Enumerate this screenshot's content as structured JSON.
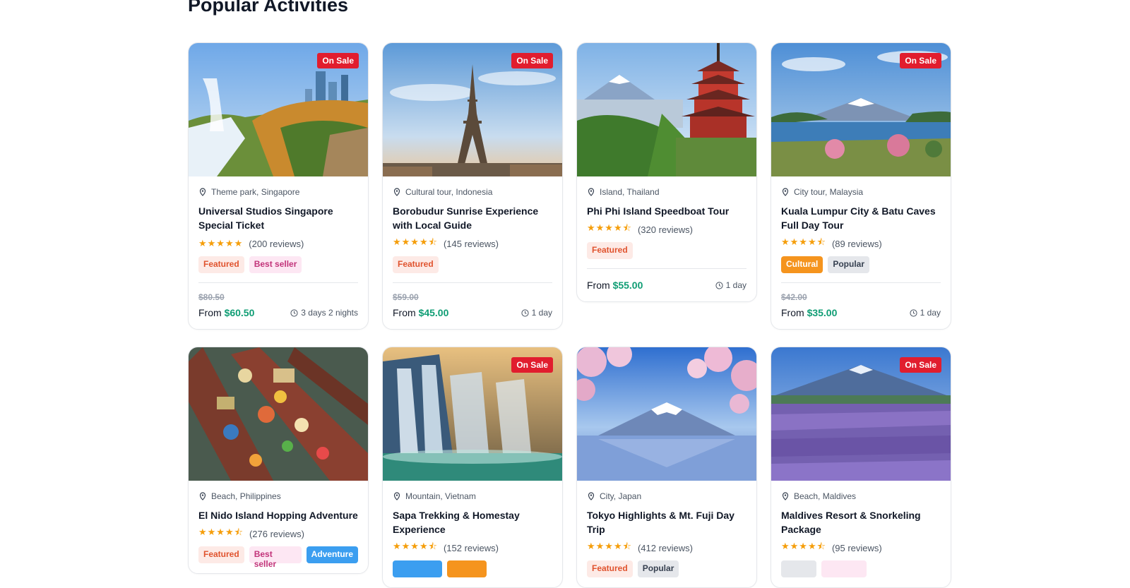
{
  "section": {
    "title": "Popular Activities"
  },
  "cards": [
    {
      "sale": "On Sale",
      "location": "Theme park, Singapore",
      "title": "Universal Studios Singapore Special Ticket",
      "stars": "★★★★★",
      "reviews": "(200 reviews)",
      "badges": [
        "Featured",
        "Best seller"
      ],
      "old_price": "$80.50",
      "from": "From",
      "price": "$60.50",
      "duration": "3 days 2 nights"
    },
    {
      "sale": "On Sale",
      "location": "Cultural tour, Indonesia",
      "title": "Borobudur Sunrise Experience with Local Guide",
      "stars": "★★★★⯪",
      "reviews": "(145 reviews)",
      "badges": [
        "Featured"
      ],
      "old_price": "$59.00",
      "from": "From",
      "price": "$45.00",
      "duration": "1 day"
    },
    {
      "sale": "",
      "location": "Island, Thailand",
      "title": "Phi Phi Island Speedboat Tour",
      "stars": "★★★★⯪",
      "reviews": "(320 reviews)",
      "badges": [
        "Featured"
      ],
      "old_price": "",
      "from": "From",
      "price": "$55.00",
      "duration": "1 day"
    },
    {
      "sale": "On Sale",
      "location": "City tour, Malaysia",
      "title": "Kuala Lumpur City & Batu Caves Full Day Tour",
      "stars": "★★★★⯪",
      "reviews": "(89 reviews)",
      "badges": [
        "Cultural",
        "Popular"
      ],
      "old_price": "$42.00",
      "from": "From",
      "price": "$35.00",
      "duration": "1 day"
    },
    {
      "sale": "",
      "location": "Beach, Philippines",
      "title": "El Nido Island Hopping Adventure",
      "stars": "★★★★⯪",
      "reviews": "(276 reviews)",
      "badges": [
        "Featured",
        "Best seller",
        "Adventure"
      ]
    },
    {
      "sale": "On Sale",
      "location": "Mountain, Vietnam",
      "title": "Sapa Trekking & Homestay Experience",
      "stars": "★★★★⯪",
      "reviews": "(152 reviews)",
      "badges": []
    },
    {
      "sale": "",
      "location": "City, Japan",
      "title": "Tokyo Highlights & Mt. Fuji Day Trip",
      "stars": "★★★★⯪",
      "reviews": "(412 reviews)",
      "badges": [
        "Featured",
        "Popular"
      ]
    },
    {
      "sale": "On Sale",
      "location": "Beach, Maldives",
      "title": "Maldives Resort & Snorkeling Package",
      "stars": "★★★★⯪",
      "reviews": "(95 reviews)",
      "badges": []
    }
  ],
  "colors": {
    "sale": "#e11d2e",
    "price": "#0f9d74",
    "star": "#f59e0b"
  }
}
